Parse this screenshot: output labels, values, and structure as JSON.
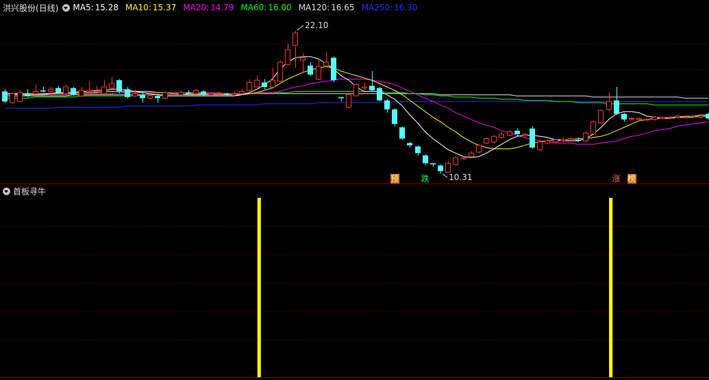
{
  "header": {
    "title": "洪兴股份(日线)",
    "ma": [
      {
        "label": "MA5:",
        "value": "15.28",
        "color": "#ffffff"
      },
      {
        "label": "MA10:",
        "value": "15.37",
        "color": "#ffff00"
      },
      {
        "label": "MA20:",
        "value": "14.79",
        "color": "#ff00ff"
      },
      {
        "label": "MA60:",
        "value": "16.00",
        "color": "#00ff00"
      },
      {
        "label": "MA120:",
        "value": "16.65",
        "color": "#dddddd"
      },
      {
        "label": "MA250:",
        "value": "16.30",
        "color": "#2a2aff"
      }
    ]
  },
  "indicator": {
    "title": "首板寻牛"
  },
  "chart_data": {
    "type": "candlestick",
    "high_label": "22.10",
    "low_label": "10.31",
    "price_range": [
      9,
      24
    ],
    "candles": [
      [
        17.2,
        16.3,
        17.4,
        16.2
      ],
      [
        16.2,
        17.0,
        17.1,
        16.1
      ],
      [
        16.3,
        17.1,
        17.3,
        16.2
      ],
      [
        17.0,
        16.8,
        17.4,
        16.7
      ],
      [
        17.0,
        17.2,
        17.8,
        16.9
      ],
      [
        17.3,
        17.2,
        17.6,
        17.1
      ],
      [
        17.2,
        17.4,
        17.6,
        17.0
      ],
      [
        17.5,
        17.1,
        17.7,
        17.0
      ],
      [
        17.0,
        17.6,
        17.8,
        16.9
      ],
      [
        17.5,
        16.9,
        17.6,
        16.8
      ],
      [
        16.8,
        17.3,
        17.6,
        16.7
      ],
      [
        17.2,
        17.3,
        18.1,
        17.1
      ],
      [
        17.2,
        17.2,
        17.7,
        17.1
      ],
      [
        17.0,
        17.6,
        18.2,
        16.9
      ],
      [
        17.5,
        17.9,
        18.5,
        17.4
      ],
      [
        18.2,
        17.2,
        18.3,
        17.0
      ],
      [
        17.4,
        16.7,
        17.6,
        16.6
      ],
      [
        16.8,
        17.0,
        17.4,
        16.7
      ],
      [
        16.9,
        16.6,
        17.2,
        16.2
      ],
      [
        16.6,
        16.8,
        17.0,
        16.5
      ],
      [
        16.8,
        16.6,
        17.0,
        16.2
      ],
      [
        16.6,
        17.1,
        17.2,
        16.5
      ],
      [
        16.9,
        16.9,
        17.1,
        16.8
      ],
      [
        16.9,
        17.1,
        17.3,
        16.8
      ],
      [
        17.1,
        17.0,
        17.3,
        16.9
      ],
      [
        17.0,
        17.3,
        17.4,
        16.9
      ],
      [
        17.2,
        16.9,
        17.3,
        16.8
      ],
      [
        16.9,
        17.0,
        17.1,
        16.8
      ],
      [
        17.0,
        17.0,
        17.2,
        16.9
      ],
      [
        17.0,
        16.9,
        17.1,
        16.8
      ],
      [
        16.9,
        17.0,
        17.2,
        16.8
      ],
      [
        17.0,
        17.2,
        17.4,
        16.9
      ],
      [
        17.3,
        18.0,
        18.3,
        17.2
      ],
      [
        17.6,
        18.2,
        18.6,
        17.5
      ],
      [
        18.0,
        17.6,
        18.3,
        17.4
      ],
      [
        17.6,
        18.2,
        19.3,
        17.5
      ],
      [
        18.1,
        19.8,
        20.0,
        18.0
      ],
      [
        19.6,
        20.9,
        21.5,
        19.5
      ],
      [
        21.3,
        22.4,
        22.6,
        19.3
      ],
      [
        20.0,
        20.2,
        20.6,
        18.8
      ],
      [
        19.5,
        18.7,
        19.8,
        18.6
      ],
      [
        18.3,
        19.4,
        20.0,
        18.2
      ],
      [
        19.5,
        19.8,
        20.7,
        19.4
      ],
      [
        20.2,
        18.2,
        20.3,
        18.0
      ],
      [
        16.7,
        16.6,
        16.7,
        16.3
      ],
      [
        15.8,
        16.9,
        17.1,
        15.7
      ],
      [
        16.8,
        17.8,
        17.9,
        16.8
      ],
      [
        17.5,
        17.6,
        18.0,
        17.3
      ],
      [
        17.7,
        17.3,
        19.0,
        17.2
      ],
      [
        17.5,
        16.4,
        17.6,
        16.3
      ],
      [
        16.4,
        15.6,
        16.5,
        15.3
      ],
      [
        15.6,
        14.3,
        15.7,
        14.1
      ],
      [
        14.0,
        13.0,
        14.1,
        12.9
      ],
      [
        12.6,
        12.4,
        12.7,
        12.2
      ],
      [
        12.3,
        11.7,
        12.4,
        11.5
      ],
      [
        11.5,
        10.8,
        11.6,
        10.7
      ],
      [
        10.8,
        10.7,
        10.8,
        10.5
      ],
      [
        10.6,
        10.1,
        10.7,
        9.9
      ],
      [
        10.0,
        10.8,
        11.0,
        10.0
      ],
      [
        10.7,
        11.3,
        11.4,
        10.6
      ],
      [
        11.2,
        11.3,
        11.4,
        11.1
      ],
      [
        11.4,
        11.7,
        11.9,
        11.3
      ],
      [
        11.8,
        12.4,
        12.5,
        11.7
      ],
      [
        12.6,
        13.0,
        13.1,
        12.5
      ],
      [
        12.7,
        13.2,
        13.3,
        12.6
      ],
      [
        13.1,
        13.4,
        13.6,
        13.0
      ],
      [
        13.3,
        13.6,
        13.8,
        13.2
      ],
      [
        13.7,
        13.4,
        13.9,
        13.2
      ],
      [
        13.3,
        13.4,
        13.5,
        13.1
      ],
      [
        13.9,
        12.2,
        14.1,
        12.1
      ],
      [
        12.0,
        12.7,
        12.9,
        11.9
      ],
      [
        12.6,
        12.8,
        13.0,
        12.5
      ],
      [
        12.7,
        12.9,
        13.0,
        12.6
      ],
      [
        12.8,
        12.9,
        13.1,
        12.7
      ],
      [
        12.9,
        13.0,
        13.1,
        12.8
      ],
      [
        12.9,
        12.8,
        13.1,
        12.7
      ],
      [
        12.8,
        13.5,
        13.6,
        12.7
      ],
      [
        13.4,
        14.5,
        14.6,
        13.3
      ],
      [
        14.4,
        15.5,
        15.6,
        14.3
      ],
      [
        15.6,
        16.3,
        17.1,
        15.4
      ],
      [
        16.4,
        15.2,
        17.6,
        15.1
      ],
      [
        15.2,
        14.7,
        15.3,
        14.5
      ],
      [
        14.8,
        14.8,
        14.9,
        14.6
      ],
      [
        14.7,
        14.8,
        14.9,
        14.6
      ],
      [
        14.7,
        14.7,
        14.8,
        14.6
      ],
      [
        14.7,
        14.9,
        15.0,
        14.6
      ],
      [
        14.8,
        14.9,
        15.0,
        14.7
      ],
      [
        14.9,
        14.9,
        15.0,
        14.8
      ],
      [
        14.9,
        15.0,
        15.1,
        14.8
      ],
      [
        14.9,
        14.9,
        15.0,
        14.8
      ],
      [
        15.0,
        15.0,
        15.1,
        14.9
      ],
      [
        14.9,
        15.0,
        15.1,
        14.8
      ],
      [
        15.2,
        14.8,
        15.3,
        14.7
      ]
    ],
    "ma_series": [
      {
        "name": "MA5",
        "color": "#ffffff",
        "values": [
          17.0,
          17.0,
          16.9,
          16.9,
          16.9,
          16.9,
          17.0,
          17.1,
          17.1,
          17.1,
          17.2,
          17.2,
          17.3,
          17.3,
          17.4,
          17.4,
          17.3,
          17.2,
          17.1,
          17.0,
          16.9,
          16.8,
          16.8,
          16.8,
          16.8,
          16.8,
          16.8,
          16.8,
          16.8,
          16.8,
          16.8,
          16.9,
          17.1,
          17.4,
          17.8,
          18.3,
          19.2,
          19.8,
          20.2,
          20.3,
          20.3,
          20.1,
          19.7,
          19.2,
          18.6,
          18.2,
          17.6,
          17.2,
          17.2,
          17.2,
          16.9,
          16.5,
          15.9,
          15.1,
          14.4,
          13.6,
          13.0,
          12.5,
          12.0,
          11.7,
          11.4,
          11.3,
          11.4,
          11.7,
          12.1,
          12.5,
          12.9,
          13.2,
          13.3,
          13.3,
          13.2,
          13.1,
          12.9,
          12.8,
          12.8,
          12.8,
          13.0,
          13.4,
          14.0,
          14.7,
          15.2,
          15.4,
          15.4,
          15.3,
          15.0,
          14.9,
          14.8,
          14.8,
          14.9,
          14.9,
          14.9,
          15.0,
          15.0
        ]
      },
      {
        "name": "MA10",
        "color": "#ffff00",
        "values": [
          17.0,
          17.0,
          17.0,
          17.0,
          17.0,
          17.0,
          17.0,
          17.0,
          17.0,
          17.0,
          17.1,
          17.1,
          17.1,
          17.2,
          17.2,
          17.2,
          17.2,
          17.2,
          17.2,
          17.2,
          17.1,
          17.1,
          17.0,
          17.0,
          16.9,
          16.9,
          16.9,
          16.9,
          16.9,
          16.9,
          16.9,
          16.9,
          17.0,
          17.1,
          17.3,
          17.5,
          17.9,
          18.3,
          18.6,
          18.9,
          19.1,
          19.3,
          19.4,
          19.3,
          19.0,
          18.8,
          18.6,
          18.4,
          18.2,
          17.9,
          17.6,
          17.3,
          16.9,
          16.4,
          15.9,
          15.4,
          14.9,
          14.5,
          14.0,
          13.6,
          13.1,
          12.7,
          12.4,
          12.2,
          12.1,
          12.1,
          12.1,
          12.2,
          12.4,
          12.6,
          12.7,
          12.8,
          12.9,
          12.9,
          12.9,
          13.0,
          13.0,
          13.1,
          13.2,
          13.4,
          13.7,
          14.0,
          14.3,
          14.6,
          14.7,
          14.8,
          14.8,
          14.9,
          14.9,
          15.0,
          15.0,
          15.1,
          15.1
        ]
      },
      {
        "name": "MA20",
        "color": "#ff00ff",
        "values": [
          16.9,
          16.9,
          16.9,
          16.9,
          16.9,
          16.9,
          16.9,
          16.9,
          16.9,
          16.9,
          17.0,
          17.0,
          17.0,
          17.0,
          17.0,
          17.1,
          17.1,
          17.1,
          17.1,
          17.1,
          17.1,
          17.1,
          17.1,
          17.1,
          17.1,
          17.1,
          17.1,
          17.1,
          17.1,
          17.0,
          17.0,
          17.0,
          17.0,
          17.0,
          17.1,
          17.1,
          17.2,
          17.4,
          17.6,
          17.7,
          17.9,
          18.0,
          18.1,
          18.2,
          18.3,
          18.3,
          18.3,
          18.3,
          18.2,
          18.1,
          18.0,
          17.8,
          17.5,
          17.2,
          16.9,
          16.6,
          16.3,
          16.0,
          15.7,
          15.3,
          15.0,
          14.7,
          14.4,
          14.2,
          14.0,
          13.7,
          13.5,
          13.3,
          13.1,
          12.9,
          12.8,
          12.7,
          12.6,
          12.6,
          12.6,
          12.5,
          12.5,
          12.5,
          12.6,
          12.7,
          12.8,
          13.0,
          13.2,
          13.3,
          13.5,
          13.7,
          13.8,
          13.9,
          14.1,
          14.2,
          14.3,
          14.4,
          14.5
        ]
      },
      {
        "name": "MA60",
        "color": "#00ff00",
        "values": [
          16.6,
          16.6,
          16.6,
          16.6,
          16.7,
          16.7,
          16.7,
          16.7,
          16.7,
          16.7,
          16.8,
          16.8,
          16.8,
          16.8,
          16.8,
          16.8,
          16.8,
          16.8,
          16.9,
          16.9,
          16.9,
          16.9,
          16.9,
          16.9,
          16.9,
          16.9,
          17.0,
          17.0,
          17.0,
          17.0,
          17.0,
          17.0,
          17.0,
          17.1,
          17.1,
          17.1,
          17.1,
          17.1,
          17.2,
          17.2,
          17.2,
          17.2,
          17.2,
          17.2,
          17.2,
          17.2,
          17.2,
          17.2,
          17.2,
          17.2,
          17.1,
          17.1,
          17.1,
          17.0,
          17.0,
          16.9,
          16.9,
          16.8,
          16.8,
          16.7,
          16.7,
          16.7,
          16.6,
          16.6,
          16.6,
          16.5,
          16.5,
          16.5,
          16.4,
          16.4,
          16.4,
          16.4,
          16.3,
          16.3,
          16.3,
          16.2,
          16.2,
          16.2,
          16.2,
          16.1,
          16.1,
          16.1,
          16.1,
          16.1,
          16.1,
          16.0,
          16.0,
          16.0,
          16.0,
          16.0,
          16.0,
          16.0,
          16.0
        ]
      },
      {
        "name": "MA120",
        "color": "#dddddd",
        "values": [
          16.8,
          16.8,
          16.8,
          16.8,
          16.8,
          16.8,
          16.8,
          16.8,
          16.8,
          16.9,
          16.9,
          16.9,
          16.9,
          16.9,
          16.9,
          16.9,
          16.9,
          16.9,
          16.9,
          16.9,
          16.9,
          16.9,
          16.9,
          16.9,
          17.0,
          17.0,
          17.0,
          17.0,
          17.0,
          17.0,
          17.0,
          17.0,
          17.0,
          17.0,
          17.0,
          17.0,
          17.0,
          17.0,
          17.0,
          17.0,
          17.0,
          17.0,
          17.0,
          17.0,
          17.0,
          17.0,
          17.0,
          17.0,
          17.0,
          17.0,
          17.0,
          17.0,
          17.0,
          17.0,
          17.0,
          17.0,
          17.0,
          16.9,
          16.9,
          16.9,
          16.9,
          16.9,
          16.9,
          16.9,
          16.9,
          16.9,
          16.9,
          16.8,
          16.8,
          16.8,
          16.8,
          16.8,
          16.8,
          16.8,
          16.8,
          16.8,
          16.8,
          16.7,
          16.7,
          16.7,
          16.7,
          16.7,
          16.7,
          16.7,
          16.7,
          16.7,
          16.7,
          16.7,
          16.7,
          16.6,
          16.6,
          16.6,
          16.6
        ]
      },
      {
        "name": "MA250",
        "color": "#2a2aff",
        "values": [
          15.7,
          15.7,
          15.7,
          15.7,
          15.7,
          15.7,
          15.7,
          15.8,
          15.8,
          15.8,
          15.8,
          15.8,
          15.8,
          15.8,
          15.8,
          15.8,
          15.9,
          15.9,
          15.9,
          15.9,
          15.9,
          15.9,
          15.9,
          15.9,
          15.9,
          16.0,
          16.0,
          16.0,
          16.0,
          16.0,
          16.0,
          16.0,
          16.0,
          16.0,
          16.1,
          16.1,
          16.1,
          16.1,
          16.1,
          16.1,
          16.1,
          16.2,
          16.2,
          16.2,
          16.2,
          16.2,
          16.2,
          16.2,
          16.2,
          16.2,
          16.2,
          16.3,
          16.3,
          16.3,
          16.3,
          16.3,
          16.3,
          16.3,
          16.3,
          16.3,
          16.3,
          16.3,
          16.3,
          16.3,
          16.3,
          16.3,
          16.3,
          16.3,
          16.3,
          16.3,
          16.3,
          16.3,
          16.3,
          16.3,
          16.3,
          16.3,
          16.3,
          16.3,
          16.3,
          16.3,
          16.3,
          16.3,
          16.3,
          16.3,
          16.3,
          16.3,
          16.3,
          16.3,
          16.3,
          16.3,
          16.3,
          16.3,
          16.3
        ]
      }
    ],
    "markers": [
      {
        "index": 51,
        "text": "预",
        "bg": "#d2691e",
        "fg": "#ffff99"
      },
      {
        "index": 55,
        "text": "跌",
        "bg": "#000000",
        "fg": "#00ff66"
      },
      {
        "index": 80,
        "text": "涨",
        "bg": "#000000",
        "fg": "#ff6666"
      },
      {
        "index": 82,
        "text": "榜",
        "bg": "#d2691e",
        "fg": "#ffff99"
      }
    ],
    "signals": [
      {
        "index": 33,
        "value": 1
      },
      {
        "index": 79,
        "value": 1
      }
    ],
    "colors": {
      "up": "#ff3232",
      "down": "#54fcfc",
      "grid": "#7a0000",
      "border": "#8b0000",
      "signal": "#ffff00"
    }
  }
}
